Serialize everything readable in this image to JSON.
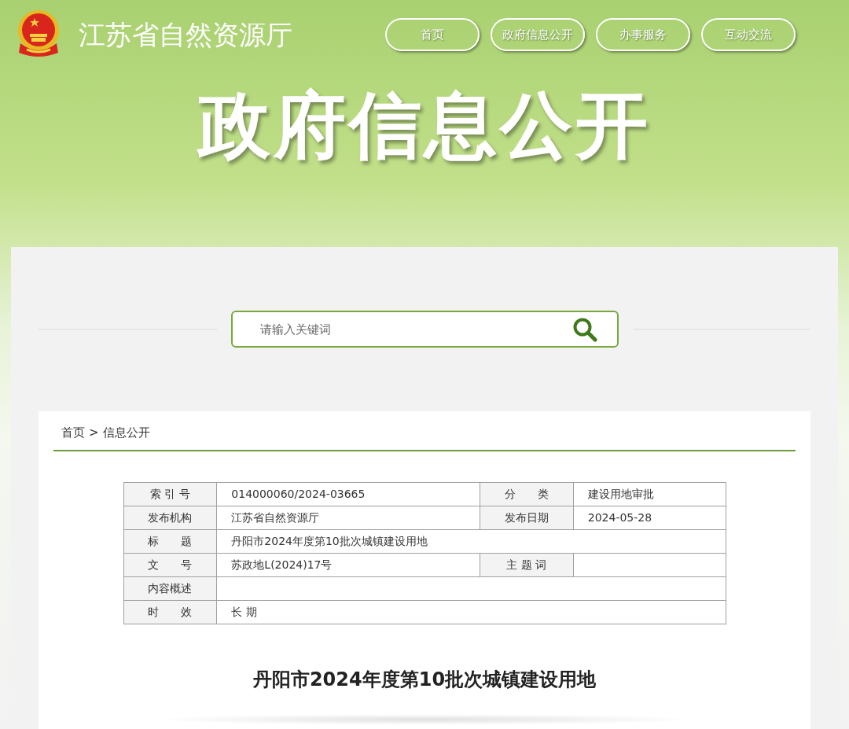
{
  "site": {
    "name": "江苏省自然资源厅"
  },
  "nav": [
    {
      "label": "首页"
    },
    {
      "label": "政府信息公开"
    },
    {
      "label": "办事服务"
    },
    {
      "label": "互动交流"
    }
  ],
  "banner": {
    "title": "政府信息公开"
  },
  "search": {
    "placeholder": "请输入关键词"
  },
  "breadcrumb": [
    {
      "label": "首页"
    },
    {
      "label": "信息公开"
    }
  ],
  "breadcrumb_separator": ">",
  "info_table": [
    {
      "cells": [
        {
          "label": "索 引 号",
          "value": "014000060/2024-03665"
        },
        {
          "label": "分　　类",
          "value": "建设用地审批"
        }
      ]
    },
    {
      "cells": [
        {
          "label": "发布机构",
          "value": "江苏省自然资源厅"
        },
        {
          "label": "发布日期",
          "value": "2024-05-28"
        }
      ]
    },
    {
      "cells": [
        {
          "label": "标　　题",
          "value": "丹阳市2024年度第10批次城镇建设用地"
        }
      ]
    },
    {
      "cells": [
        {
          "label": "文　　号",
          "value": "苏政地L(2024)17号"
        },
        {
          "label": "主 题 词"
        }
      ]
    },
    {
      "cells": [
        {
          "label": "内容概述"
        }
      ]
    },
    {
      "cells": [
        {
          "label": "时　　效",
          "value": "长 期"
        }
      ]
    }
  ],
  "article": {
    "title": "丹阳市2024年度第10批次城镇建设用地"
  }
}
